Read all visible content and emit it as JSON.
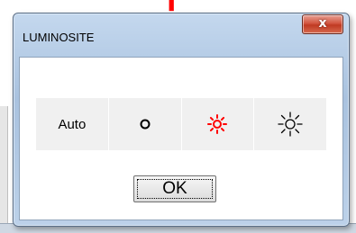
{
  "window": {
    "title": "LUMINOSITE",
    "close_label": "x"
  },
  "modes": [
    {
      "id": "auto",
      "label": "Auto",
      "icon": "text"
    },
    {
      "id": "low",
      "label": "",
      "icon": "circle-icon"
    },
    {
      "id": "medium",
      "label": "",
      "icon": "sun-icon",
      "color": "#ff0000"
    },
    {
      "id": "high",
      "label": "",
      "icon": "sun-icon",
      "color": "#000000"
    }
  ],
  "ok_button": {
    "label": "OK"
  },
  "background_marker": {
    "text": "I",
    "color": "#ff0000"
  }
}
